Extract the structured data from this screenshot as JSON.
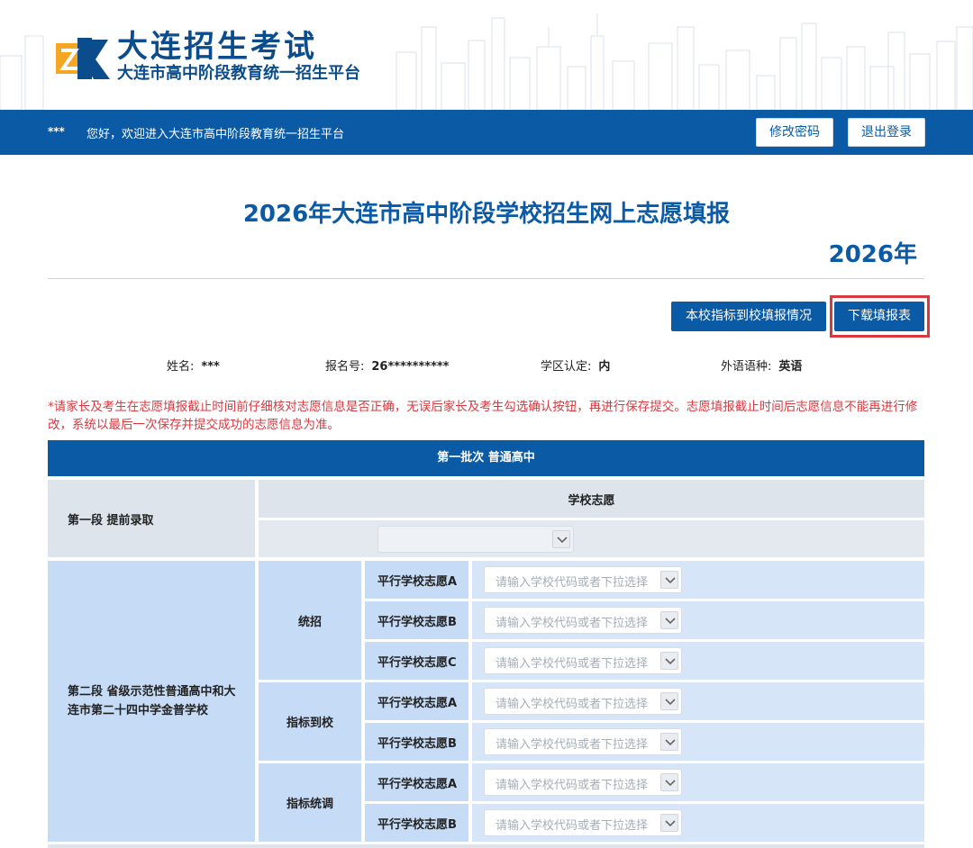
{
  "header": {
    "brand_title": "大连招生考试",
    "brand_subtitle": "大连市高中阶段教育统一招生平台"
  },
  "nav": {
    "user": "***",
    "welcome": "您好，欢迎进入大连市高中阶段教育统一招生平台",
    "change_password": "修改密码",
    "logout": "退出登录"
  },
  "main": {
    "title": "2026年大连市高中阶段学校招生网上志愿填报",
    "year": "2026年",
    "btn_report": "本校指标到校填报情况",
    "btn_download": "下载填报表"
  },
  "student": {
    "name_label": "姓名:",
    "name_value": "***",
    "reg_label": "报名号:",
    "reg_value": "26**********",
    "district_label": "学区认定:",
    "district_value": "内",
    "language_label": "外语语种:",
    "language_value": "英语"
  },
  "notice": "*请家长及考生在志愿填报截止时间前仔细核对志愿信息是否正确，无误后家长及考生勾选确认按钮，再进行保存提交。志愿填报截止时间后志愿信息不能再进行修改，系统以最后一次保存并提交成功的志愿信息为准。",
  "table": {
    "batch_header": "第一批次   普通高中",
    "segment1": {
      "label": "第一段  提前录取",
      "column_header": "学校志愿"
    },
    "segment2": {
      "label": "第二段  省级示范性普通高中和大连市第二十四中学金普学校",
      "groups": [
        {
          "name": "统招",
          "rows": [
            "平行学校志愿A",
            "平行学校志愿B",
            "平行学校志愿C"
          ]
        },
        {
          "name": "指标到校",
          "rows": [
            "平行学校志愿A",
            "平行学校志愿B"
          ]
        },
        {
          "name": "指标统调",
          "rows": [
            "平行学校志愿A",
            "平行学校志愿B"
          ]
        }
      ]
    },
    "select_placeholder": "请输入学校代码或者下拉选择"
  },
  "colors": {
    "primary": "#0b5aa6",
    "notice_red": "#d9383f",
    "cell_blue": "#c6dbf5",
    "cell_grey": "#dde4ec"
  }
}
